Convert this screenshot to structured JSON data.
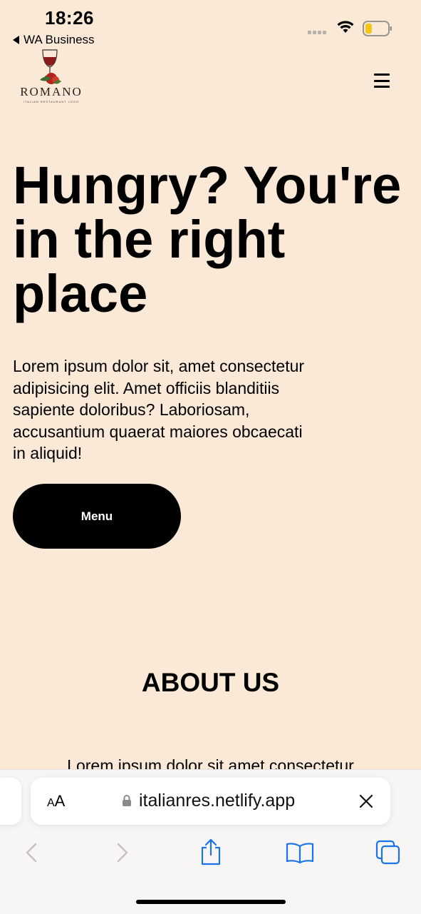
{
  "status_bar": {
    "time": "18:26",
    "back_app": "WA Business",
    "battery_color": "#f5c518"
  },
  "header": {
    "logo_word": "ROMANO",
    "logo_subtitle": "ITALIAN RESTAURANT LOGO",
    "menu_icon": "hamburger-icon"
  },
  "hero": {
    "title": "Hungry? You're in the right place",
    "text": "Lorem ipsum dolor sit, amet consectetur adipisicing elit. Amet officiis blanditiis sapiente doloribus? Laboriosam, accusantium quaerat maiores obcaecati in aliquid!",
    "button_label": "Menu"
  },
  "about": {
    "title": "ABOUT US",
    "text_partial": "Lorem ipsum dolor sit amet consectetur"
  },
  "browser": {
    "text_size_label_big": "A",
    "text_size_label_small": "A",
    "url": "italianres.netlify.app",
    "accent_color": "#1a73e8"
  },
  "colors": {
    "page_background": "#fbe9d8",
    "button_background": "#000000"
  }
}
